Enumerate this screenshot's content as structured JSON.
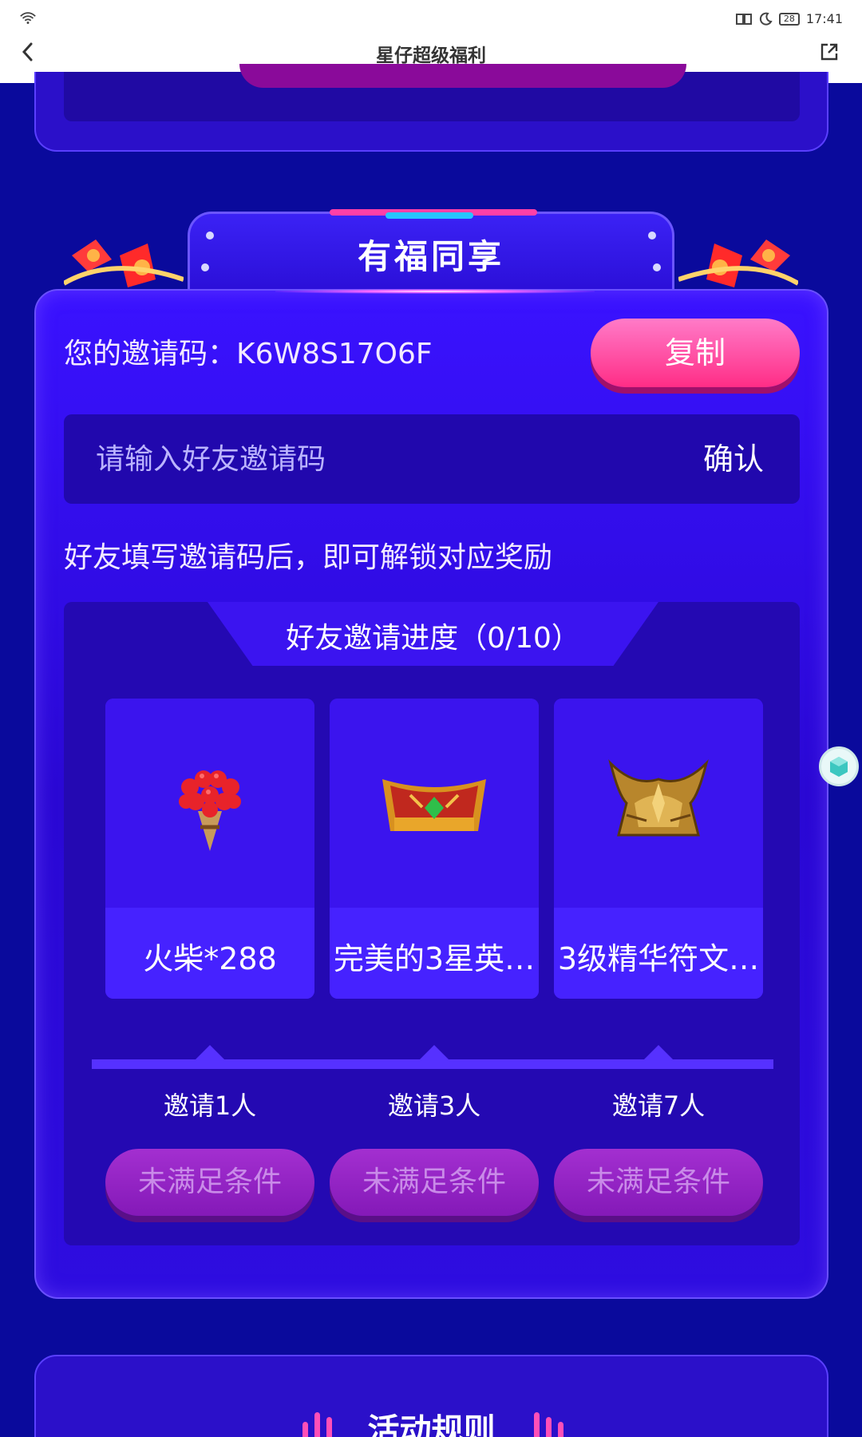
{
  "status_bar": {
    "time": "17:41",
    "battery": "28"
  },
  "header": {
    "title": "星仔超级福利"
  },
  "banner": {
    "title": "有福同享"
  },
  "invite": {
    "code_label": "您的邀请码：K6W8S17O6F",
    "copy_label": "复制",
    "input_placeholder": "请输入好友邀请码",
    "confirm_label": "确认",
    "hint": "好友填写邀请码后，即可解锁对应奖励"
  },
  "progress": {
    "title": "好友邀请进度（0/10）",
    "rewards": [
      {
        "name": "火柴*288",
        "icon": "flower-bouquet-icon",
        "tier": "邀请1人",
        "button": "未满足条件"
      },
      {
        "name": "完美的3星英…",
        "icon": "treasure-chest-icon",
        "tier": "邀请3人",
        "button": "未满足条件"
      },
      {
        "name": "3级精华符文…",
        "icon": "golden-crown-icon",
        "tier": "邀请7人",
        "button": "未满足条件"
      }
    ]
  },
  "rules": {
    "title": "活动规则"
  },
  "colors": {
    "background": "#0a0a9c",
    "card": "#2b10c9",
    "accent_pink": "#ff2d86",
    "button_disabled": "#8419b8"
  }
}
